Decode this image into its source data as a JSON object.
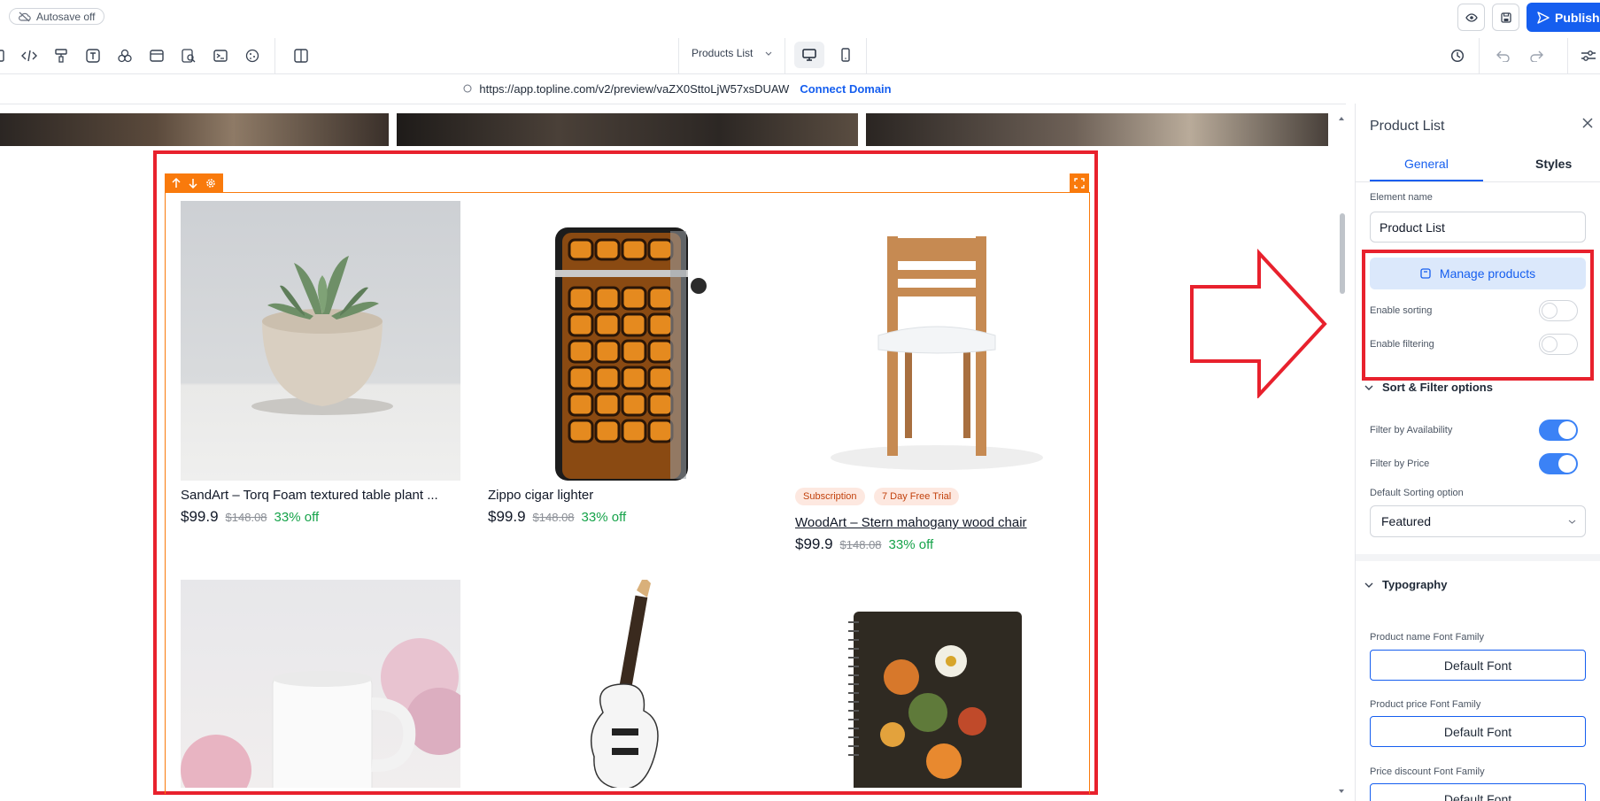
{
  "topbar": {
    "autosave_label": "Autosave off",
    "publish_label": "Publish"
  },
  "toolbar": {
    "page_select": "Products List"
  },
  "urlbar": {
    "url": "https://app.topline.com/v2/preview/vaZX0SttoLjW57xsDUAW",
    "connect_domain": "Connect Domain"
  },
  "products": [
    {
      "name": "SandArt – Torq Foam textured table plant ...",
      "price": "$99.9",
      "old_price": "$148.08",
      "discount": "33% off",
      "badges": []
    },
    {
      "name": "Zippo cigar lighter",
      "price": "$99.9",
      "old_price": "$148.08",
      "discount": "33% off",
      "badges": []
    },
    {
      "name": "WoodArt – Stern mahogany wood chair",
      "price": "$99.9",
      "old_price": "$148.08",
      "discount": "33% off",
      "badges": [
        "Subscription",
        "7 Day Free Trial"
      ]
    }
  ],
  "panel": {
    "title": "Product List",
    "tabs": [
      "General",
      "Styles"
    ],
    "element_name_label": "Element name",
    "element_name_value": "Product List",
    "manage_products_label": "Manage products",
    "enable_sorting_label": "Enable sorting",
    "enable_sorting": false,
    "enable_filtering_label": "Enable filtering",
    "enable_filtering": false,
    "sort_filter_section": "Sort & Filter options",
    "filter_availability_label": "Filter by Availability",
    "filter_availability": true,
    "filter_price_label": "Filter by Price",
    "filter_price": true,
    "default_sorting_label": "Default Sorting option",
    "default_sorting_value": "Featured",
    "typography_section": "Typography",
    "name_font_label": "Product name Font Family",
    "name_font_value": "Default Font",
    "price_font_label": "Product price Font Family",
    "price_font_value": "Default Font",
    "discount_font_label": "Price discount Font Family",
    "discount_font_value": "Default Font"
  },
  "colors": {
    "accent": "#155eef",
    "highlight_red": "#e8212d",
    "element_orange": "#f97a0c",
    "discount_green": "#16a34a"
  }
}
